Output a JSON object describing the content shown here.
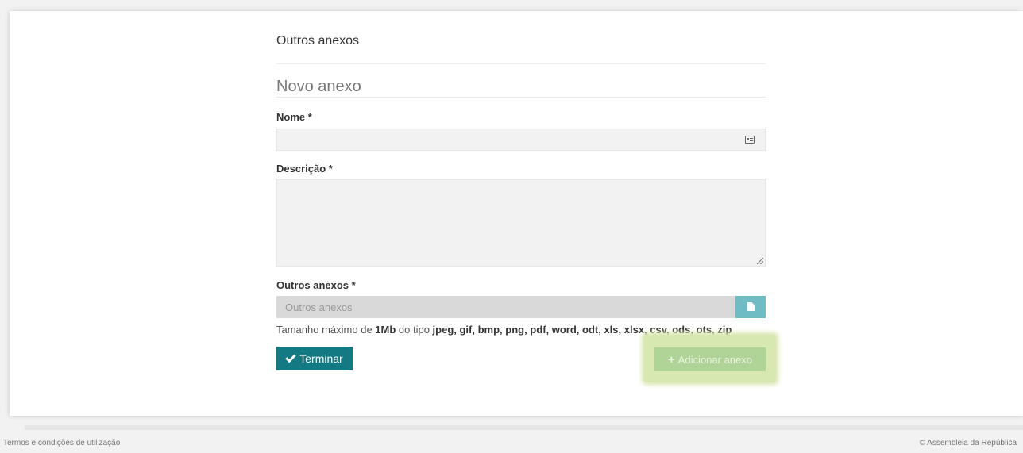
{
  "section_title": "Outros anexos",
  "form": {
    "legend": "Novo anexo",
    "nome_label": "Nome *",
    "nome_value": "",
    "nome_icon": "address-card-icon",
    "descricao_label": "Descrição *",
    "descricao_value": "",
    "anexos_label": "Outros anexos *",
    "anexos_placeholder": "Outros anexos",
    "file_button_icon": "file-icon",
    "hint": {
      "prefix": "Tamanho máximo de ",
      "size": "1Mb",
      "middle": " do tipo ",
      "types": "jpeg, gif, bmp, png, pdf, word, odt, xls, xlsx, csv, ods, ots, zip"
    }
  },
  "buttons": {
    "terminar": "Terminar",
    "terminar_icon": "check-icon",
    "adicionar": "Adicionar anexo",
    "adicionar_icon": "plus-icon"
  },
  "footer": {
    "left": "Termos e condições de utilização",
    "right": "© Assembleia da República"
  },
  "colors": {
    "primary": "#137a83",
    "file_button": "#6fbcc4",
    "add_button": "#b0d497",
    "highlight": "#d7e8b0"
  }
}
